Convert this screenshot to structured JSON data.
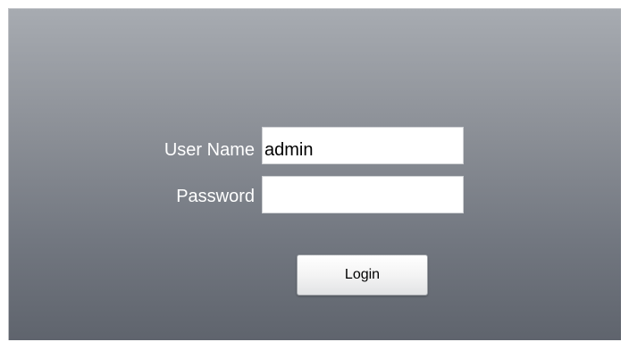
{
  "form": {
    "username_label": "User Name",
    "username_value": "admin",
    "password_label": "Password",
    "password_value": "",
    "login_label": "Login"
  }
}
